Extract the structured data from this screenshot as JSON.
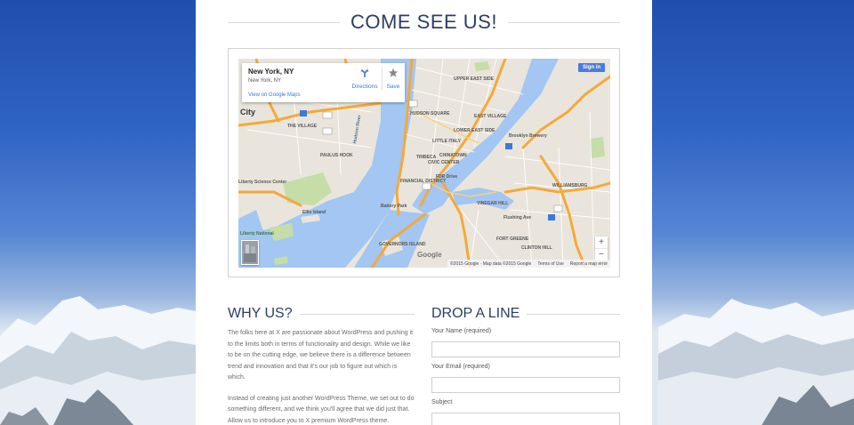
{
  "page": {
    "title": "COME SEE US!"
  },
  "map": {
    "info_card": {
      "place": "New York, NY",
      "address": "New York, NY",
      "view_link": "View on Google Maps",
      "directions_label": "Directions",
      "save_label": "Save",
      "directions_icon": "directions-arrow-icon",
      "save_icon": "star-icon"
    },
    "sign_in": "Sign in",
    "zoom_in": "+",
    "zoom_out": "−",
    "google_logo": "Google",
    "attribution": {
      "copyright": "©2015 Google · Map data ©2015 Google",
      "terms": "Terms of Use",
      "report": "Report a map error"
    },
    "labels": {
      "city": "City",
      "the_village": "THE VILLAGE",
      "upper_east_side": "UPPER EAST SIDE",
      "east_village": "EAST VILLAGE",
      "tribeca": "TRIBECA",
      "little_italy": "LITTLE ITALY",
      "chinatown": "CHINATOWN",
      "civic_center": "CIVIC CENTER",
      "financial_district": "FINANCIAL DISTRICT",
      "battery_park": "Battery Park",
      "ellis_island": "Ellis Island",
      "governors_island": "GOVERNORS ISLAND",
      "liberty_science_center": "Liberty Science Center",
      "paulus_hook": "PAULUS HOOK",
      "brooklyn_brewery": "Brooklyn Brewery",
      "williamsburg": "WILLIAMSBURG",
      "vinegar_hill": "VINEGAR HILL",
      "fort_greene": "FORT GREENE",
      "clinton_hill": "CLINTON HILL",
      "hudson_square": "HUDSON SQUARE",
      "lower_east_side": "LOWER EAST SIDE",
      "fdr_drive": "FDR Drive",
      "statue_national": "Liberty National",
      "hudson_river": "Hudson River",
      "fishing_ave": "Flushing Ave"
    },
    "colors": {
      "water": "#a3c6f2",
      "land": "#e9e5dc",
      "park": "#c6dda8",
      "highway": "#f4a93a",
      "road": "#ffffff"
    }
  },
  "why_us": {
    "title": "WHY US?",
    "paragraphs": [
      "The folks here at X are passionate about WordPress and pushing it to the limits both in terms of functionality and design. While we like to be on the cutting edge, we believe there is a difference between trend and innovation and that it's our job to figure out which is which.",
      "Instead of creating just another WordPress Theme, we set out to do something different, and we think you'll agree that we did just that. Allow us to introduce you to X premium WordPress theme."
    ]
  },
  "contact": {
    "title": "DROP A LINE",
    "fields": [
      {
        "label": "Your Name (required)",
        "value": ""
      },
      {
        "label": "Your Email (required)",
        "value": ""
      },
      {
        "label": "Subject",
        "value": ""
      }
    ]
  }
}
